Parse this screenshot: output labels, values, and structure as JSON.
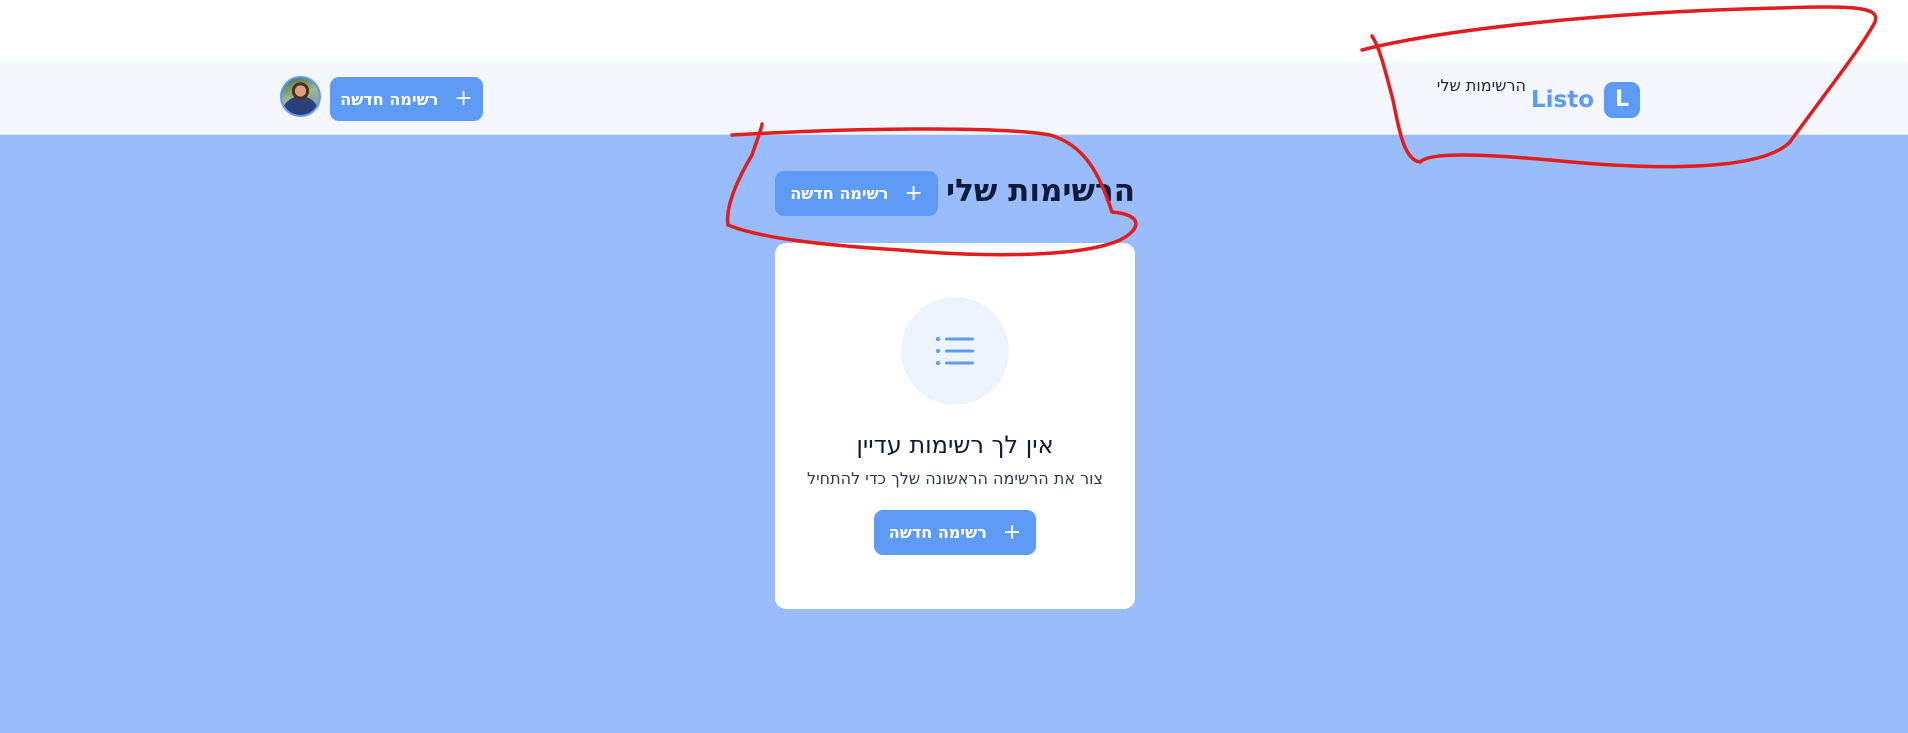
{
  "navbar": {
    "brand_name": "Listo",
    "brand_logo_letter": "L",
    "nav_link": "הרשימות שלי",
    "new_list_label": "רשימה חדשה",
    "plus": "+"
  },
  "main": {
    "title": "הרשימות שלי",
    "new_list_label": "רשימה חדשה",
    "plus": "+"
  },
  "empty_state": {
    "icon": "list-icon",
    "title": "אין לך רשימות עדיין",
    "subtitle": "צור את הרשימה הראשונה שלך כדי להתחיל",
    "new_list_label": "רשימה חדשה",
    "plus": "+"
  },
  "colors": {
    "accent": "#5e9bf6",
    "main_background": "#99bdfb",
    "navbar_background": "#f4f7fd",
    "annotation": "#e11d1d"
  }
}
